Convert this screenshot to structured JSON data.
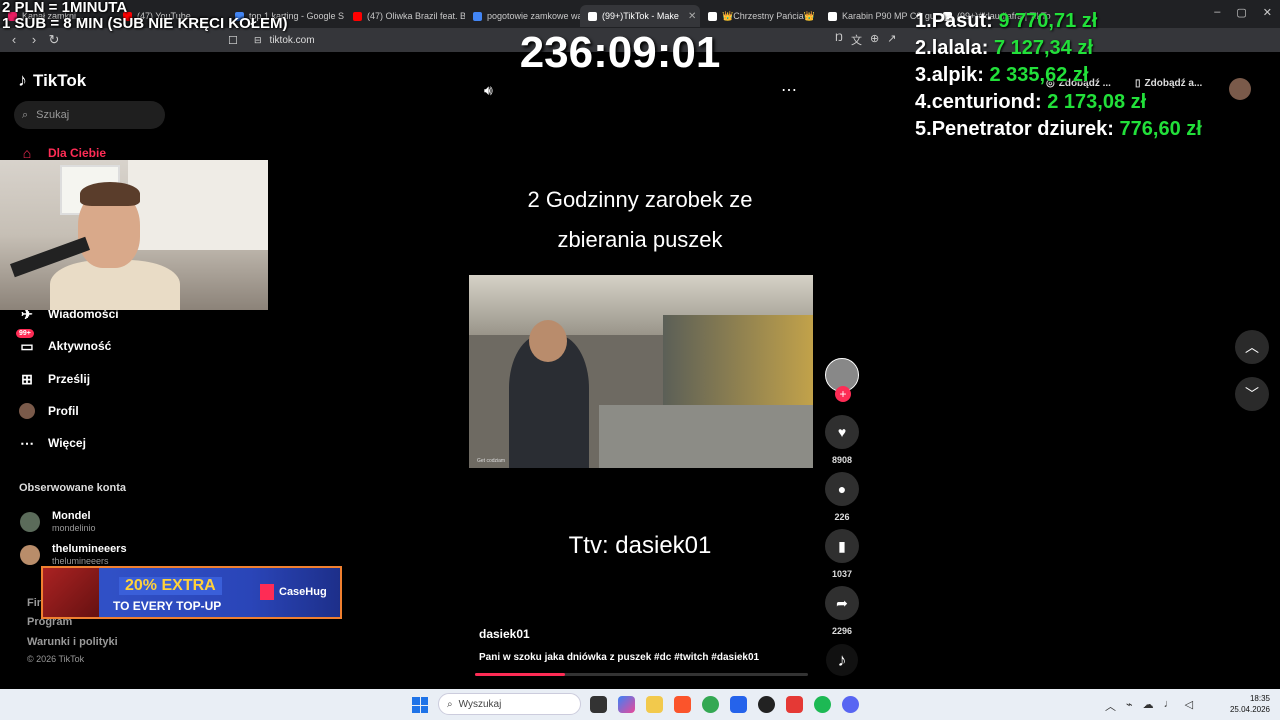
{
  "browser": {
    "tabs": [
      {
        "label": "Kanał zamkni...",
        "favicon_color": "#e91e63"
      },
      {
        "label": "(47) YouTube",
        "favicon_color": "#ff0000"
      },
      {
        "label": "top 1 karting - Google S",
        "favicon_color": "#4285f4"
      },
      {
        "label": "(47) Oliwka Brazil feat. B",
        "favicon_color": "#ff0000"
      },
      {
        "label": "pogotowie zamkowe wa",
        "favicon_color": "#4285f4"
      },
      {
        "label": "(99+)TikTok - Make",
        "favicon_color": "#ffffff",
        "active": true
      },
      {
        "label": "👑Chrzestny Pańcia👑",
        "favicon_color": "#ffffff"
      },
      {
        "label": "Karabin P90 MP CS gu",
        "favicon_color": "#ffffff"
      },
      {
        "label": "(99+)#klaudiafra | TikTo",
        "favicon_color": "#ffffff"
      }
    ],
    "url": "tiktok.com"
  },
  "overlay": {
    "donate_rate_line1": "2 PLN = 1MINUTA",
    "donate_rate_line2": "1 SUB = 8 MIN (SUB NIE KRĘCI KOŁEM)",
    "timer": "236:09:01",
    "leaderboard": [
      {
        "rank": "1.",
        "name": "Pasut:",
        "amount": "9 770,71 zł"
      },
      {
        "rank": "2.",
        "name": "lalala:",
        "amount": "7 127,34 zł"
      },
      {
        "rank": "3.",
        "name": "alpik:",
        "amount": "2 335,62 zł"
      },
      {
        "rank": "4.",
        "name": "centuriond:",
        "amount": "2 173,08 zł"
      },
      {
        "rank": "5.",
        "name": "Penetrator dziurek:",
        "amount": "776,60 zł"
      }
    ]
  },
  "sidebar": {
    "logo": "TikTok",
    "search_placeholder": "Szukaj",
    "items": [
      {
        "label": "Dla Ciebie",
        "icon": "home-icon"
      },
      {
        "label": "Wiadomości",
        "icon": "messages-icon"
      },
      {
        "label": "Aktywność",
        "icon": "activity-icon",
        "badge": "99+"
      },
      {
        "label": "Prześlij",
        "icon": "upload-icon"
      },
      {
        "label": "Profil",
        "icon": "profile-icon"
      },
      {
        "label": "Więcej",
        "icon": "more-icon"
      }
    ],
    "followed_title": "Obserwowane konta",
    "followed": [
      {
        "name": "Mondel",
        "handle": "mondelinio"
      },
      {
        "name": "thelumineeers",
        "handle": "thelumineeers"
      }
    ],
    "footer": [
      "Fir",
      "Program",
      "Warunki i polityki"
    ],
    "copyright": "© 2026 TikTok"
  },
  "topbar": {
    "get_coins": "Zdobądź ...",
    "get_app": "Zdobądź a..."
  },
  "video": {
    "caption_top_1": "2 Godzinny zarobek ze",
    "caption_top_2": "zbierania puszek",
    "caption_bottom": "Ttv: dasiek01",
    "author": "dasiek01",
    "description": "Pani w szoku jaka dniówka z puszek #dc #twitch #dasiek01",
    "inner_tag": "Get codziam",
    "progress": 0.27
  },
  "actions": {
    "likes": "8908",
    "comments": "226",
    "saves": "1037",
    "shares": "2296"
  },
  "ad": {
    "line1": "20% EXTRA",
    "line2": "TO EVERY TOP-UP",
    "brand": "CaseHug"
  },
  "taskbar": {
    "search_placeholder": "Wyszukaj",
    "time": "18:35",
    "date": "25.04.2026"
  }
}
